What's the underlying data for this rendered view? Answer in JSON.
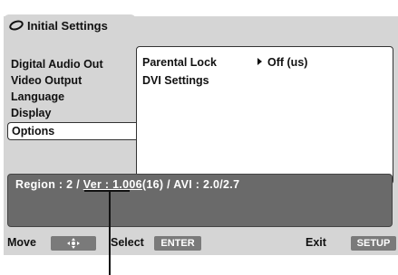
{
  "title": "Initial Settings",
  "menu_items": [
    "Digital Audio Out",
    "Video Output",
    "Language",
    "Display",
    "Options"
  ],
  "selected_menu": "Options",
  "options": [
    {
      "label": "Parental Lock",
      "value": "Off (us)"
    },
    {
      "label": "DVI Settings",
      "value": ""
    }
  ],
  "info_text": {
    "region": "Region : 2 / ",
    "ver": "Ver : 1.006",
    "rest": "(16) / AVI : 2.0/2.7"
  },
  "help": {
    "move": "Move",
    "select": "Select",
    "enter_key": "ENTER",
    "exit": "Exit",
    "setup_key": "SETUP",
    "move_key_icon": "arrow-keys-icon"
  },
  "colors": {
    "panel": "#d5d5d5",
    "info_box": "#6a6a6a",
    "key": "#7a7a7a"
  }
}
